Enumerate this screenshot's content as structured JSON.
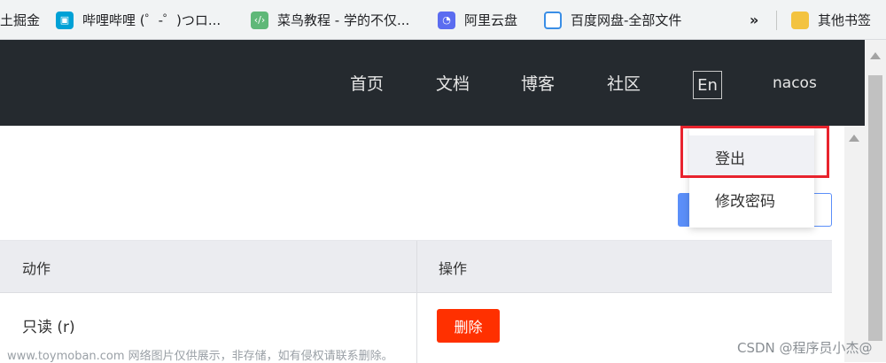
{
  "bookmarks": {
    "items": [
      {
        "label": "土掘金",
        "icon": "juejin-icon"
      },
      {
        "label": "哔哩哔哩 (゜-゜)つロ...",
        "icon": "bilibili-icon"
      },
      {
        "label": "菜鸟教程 - 学的不仅...",
        "icon": "runoob-icon"
      },
      {
        "label": "阿里云盘",
        "icon": "aliyun-drive-icon"
      },
      {
        "label": "百度网盘-全部文件",
        "icon": "baidu-pan-icon"
      }
    ],
    "more": "»",
    "other": "其他书签"
  },
  "nav": {
    "items": [
      "首页",
      "文档",
      "博客",
      "社区"
    ],
    "lang": "En",
    "user": "nacos"
  },
  "dropdown": {
    "items": [
      "登出",
      "修改密码"
    ]
  },
  "table": {
    "headers": [
      "动作",
      "操作"
    ],
    "rows": [
      {
        "action": "只读 (r)",
        "op_label": "删除"
      }
    ]
  },
  "colors": {
    "nav_bg": "#252a2f",
    "danger": "#ff3000",
    "highlight": "#e8232d",
    "primary": "#5b8ff9"
  },
  "watermark": {
    "left": "www.toymoban.com 网络图片仅供展示，非存储，如有侵权请联系删除。",
    "right": "CSDN @程序员小杰@"
  }
}
